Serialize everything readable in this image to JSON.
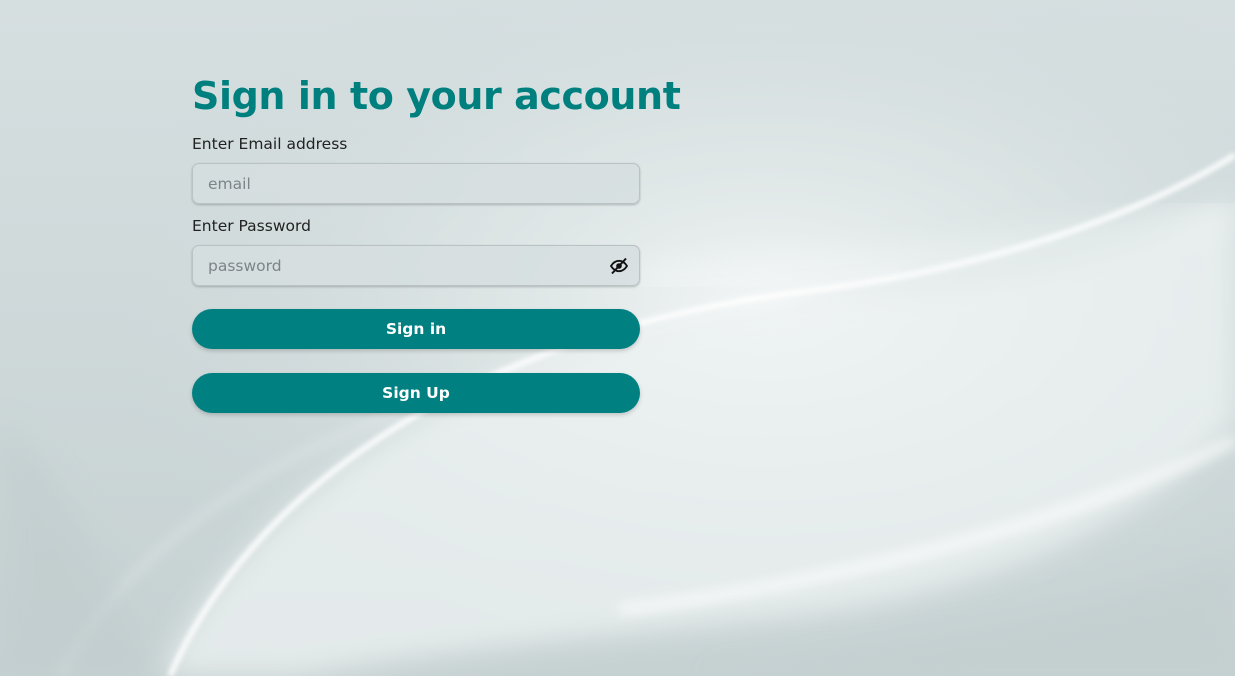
{
  "page": {
    "title": "Sign in to your account"
  },
  "email": {
    "label": "Enter Email address",
    "placeholder": "email",
    "value": ""
  },
  "password": {
    "label": "Enter Password",
    "placeholder": "password",
    "value": "",
    "toggle_icon": "eye-slash-icon"
  },
  "buttons": {
    "signin_label": "Sign in",
    "signup_label": "Sign Up"
  },
  "colors": {
    "accent": "#008080",
    "title": "#007f7f",
    "background": "#cdd8d9"
  }
}
